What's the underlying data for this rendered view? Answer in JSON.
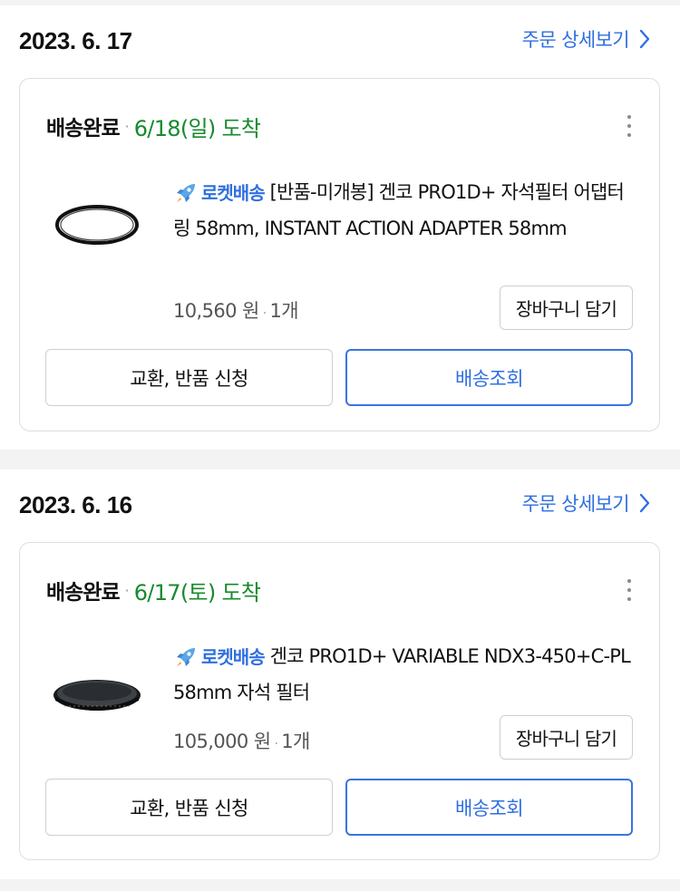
{
  "orders": [
    {
      "date": "2023. 6. 17",
      "detail_label": "주문 상세보기",
      "status": "배송완료",
      "arrival": "6/18(일) 도착",
      "rocket_label": "로켓배송",
      "product_title": "[반품-미개봉] 겐코 PRO1D+ 자석필터 어댑터 링 58mm, INSTANT ACTION ADAPTER 58mm",
      "price": "10,560 원",
      "quantity": "1개",
      "cart_label": "장바구니 담기",
      "return_label": "교환, 반품 신청",
      "track_label": "배송조회",
      "thumbnail_icon": "adapter-ring-icon"
    },
    {
      "date": "2023. 6. 16",
      "detail_label": "주문 상세보기",
      "status": "배송완료",
      "arrival": "6/17(토) 도착",
      "rocket_label": "로켓배송",
      "product_title": "겐코 PRO1D+ VARIABLE NDX3-450+C-PL 58mm 자석 필터",
      "price": "105,000 원",
      "quantity": "1개",
      "cart_label": "장바구니 담기",
      "return_label": "교환, 반품 신청",
      "track_label": "배송조회",
      "thumbnail_icon": "nd-filter-icon"
    }
  ],
  "colors": {
    "accent_blue": "#2f6fe0",
    "arrival_green": "#178a2e",
    "divider_gray": "#f3f3f3"
  }
}
